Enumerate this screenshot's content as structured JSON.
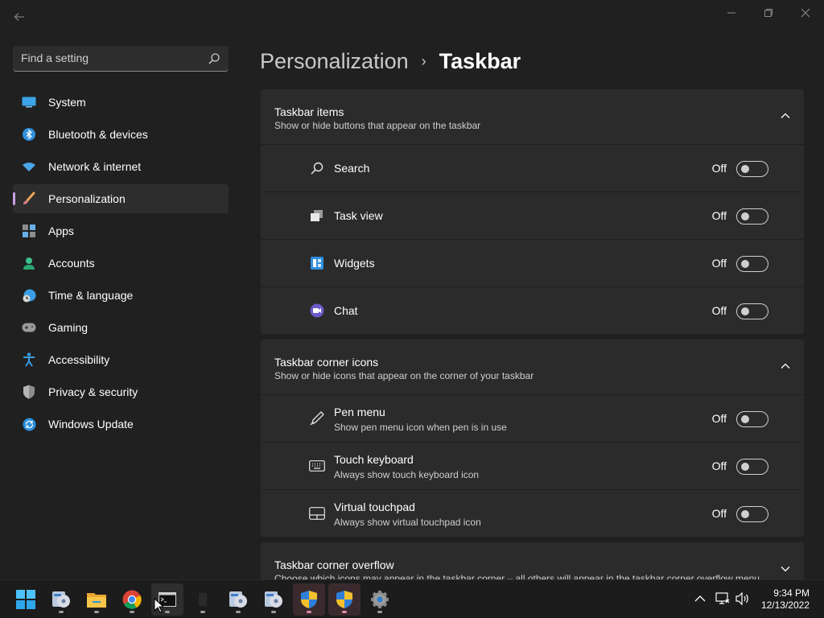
{
  "window": {
    "back_icon": "back-arrow-icon",
    "controls": [
      "minimize-icon",
      "maximize-icon",
      "close-icon"
    ]
  },
  "search": {
    "placeholder": "Find a setting",
    "icon": "search-icon"
  },
  "sidebar": {
    "items": [
      {
        "label": "System",
        "icon": "monitor-icon",
        "active": false
      },
      {
        "label": "Bluetooth & devices",
        "icon": "bluetooth-icon",
        "active": false
      },
      {
        "label": "Network & internet",
        "icon": "wifi-icon",
        "active": false
      },
      {
        "label": "Personalization",
        "icon": "paintbrush-icon",
        "active": true
      },
      {
        "label": "Apps",
        "icon": "apps-icon",
        "active": false
      },
      {
        "label": "Accounts",
        "icon": "person-icon",
        "active": false
      },
      {
        "label": "Time & language",
        "icon": "clock-globe-icon",
        "active": false
      },
      {
        "label": "Gaming",
        "icon": "gamepad-icon",
        "active": false
      },
      {
        "label": "Accessibility",
        "icon": "accessibility-icon",
        "active": false
      },
      {
        "label": "Privacy & security",
        "icon": "shield-icon",
        "active": false
      },
      {
        "label": "Windows Update",
        "icon": "update-icon",
        "active": false
      }
    ]
  },
  "header": {
    "parent": "Personalization",
    "separator": "›",
    "current": "Taskbar"
  },
  "groups": [
    {
      "title": "Taskbar items",
      "subtitle": "Show or hide buttons that appear on the taskbar",
      "expanded": true,
      "rows": [
        {
          "label": "Search",
          "state": "Off",
          "icon": "search-icon"
        },
        {
          "label": "Task view",
          "state": "Off",
          "icon": "task-view-icon"
        },
        {
          "label": "Widgets",
          "state": "Off",
          "icon": "widgets-icon"
        },
        {
          "label": "Chat",
          "state": "Off",
          "icon": "chat-icon"
        }
      ]
    },
    {
      "title": "Taskbar corner icons",
      "subtitle": "Show or hide icons that appear on the corner of your taskbar",
      "expanded": true,
      "rows": [
        {
          "label": "Pen menu",
          "desc": "Show pen menu icon when pen is in use",
          "state": "Off",
          "icon": "pen-icon"
        },
        {
          "label": "Touch keyboard",
          "desc": "Always show touch keyboard icon",
          "state": "Off",
          "icon": "keyboard-icon"
        },
        {
          "label": "Virtual touchpad",
          "desc": "Always show virtual touchpad icon",
          "state": "Off",
          "icon": "touchpad-icon"
        }
      ]
    },
    {
      "title": "Taskbar corner overflow",
      "subtitle": "Choose which icons may appear in the taskbar corner – all others will appear in the taskbar corner overflow menu",
      "expanded": false,
      "rows": []
    }
  ],
  "taskbar": {
    "apps": [
      "windows-start-icon",
      "dvd-maker-icon",
      "file-explorer-icon",
      "chrome-icon",
      "terminal-icon",
      "blank-app-icon",
      "dvd-maker-icon",
      "dvd-maker-icon",
      "uac-shield-icon",
      "uac-shield-icon",
      "settings-gear-icon"
    ],
    "tray": [
      "chevron-up-icon",
      "network-icon",
      "volume-icon"
    ],
    "time": "9:34 PM",
    "date": "12/13/2022"
  },
  "colors": {
    "background": "#202020",
    "card": "#2b2b2b",
    "accent": "#c8a0e0"
  }
}
